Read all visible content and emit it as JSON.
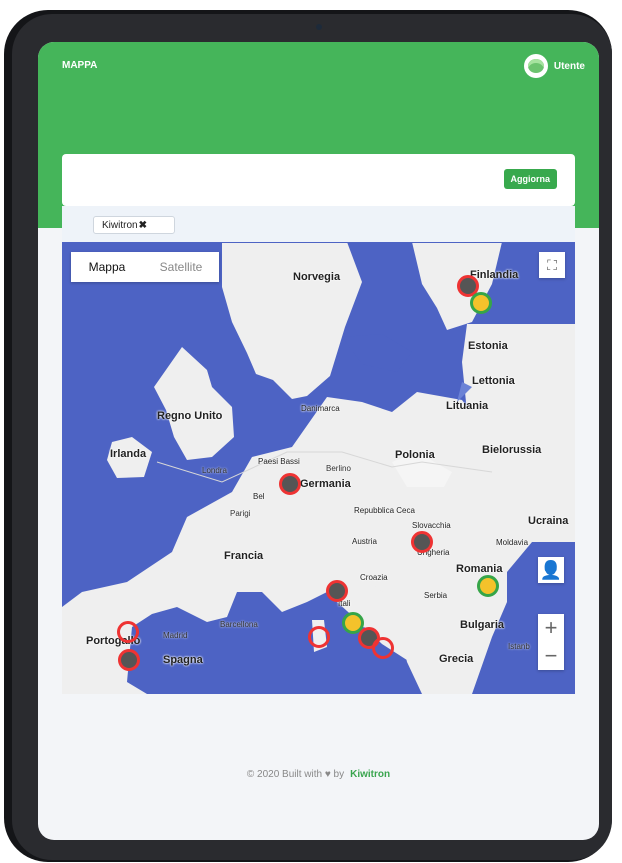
{
  "app": {
    "brand": "MAPPA",
    "user": "Utente",
    "refresh": "Aggiorna",
    "filter": "Kiwitron",
    "filter_remove": "✖"
  },
  "map": {
    "mappa": "Mappa",
    "satellite": "Satellite",
    "fullscreen": "⛶",
    "pegman": "👤",
    "zoom_in": "+",
    "zoom_out": "−"
  },
  "labels": {
    "norvegia": "Norvegia",
    "finlandia": "Finlandia",
    "estonia": "Estonia",
    "lettonia": "Lettonia",
    "lituania": "Lituania",
    "regno_unito": "Regno Unito",
    "irlanda": "Irlanda",
    "danimarca": "Danimarca",
    "paesi_bassi": "Paesi Bassi",
    "germania": "Germania",
    "londra": "Londra",
    "berlino": "Berlino",
    "polonia": "Polonia",
    "bielorussia": "Bielorussia",
    "belgio": "Bel",
    "parigi": "Parigi",
    "francia": "Francia",
    "repubblica_ceca": "Repubblica Ceca",
    "slovacchia": "Slovacchia",
    "ungheria": "Ungheria",
    "austria": "Austria",
    "ucraina": "Ucraina",
    "moldavia": "Moldavia",
    "romania": "Romania",
    "croazia": "Croazia",
    "serbia": "Serbia",
    "bulgaria": "Bulgaria",
    "istanbul": "Istanb",
    "grecia": "Grecia",
    "portogallo": "Portogallo",
    "madrid": "Madrid",
    "spagna": "Spagna",
    "barcellona": "Barcellona",
    "italia": "Itali"
  },
  "footer": {
    "text": "© 2020 Built with ♥ by",
    "brand": "Kiwitron"
  }
}
